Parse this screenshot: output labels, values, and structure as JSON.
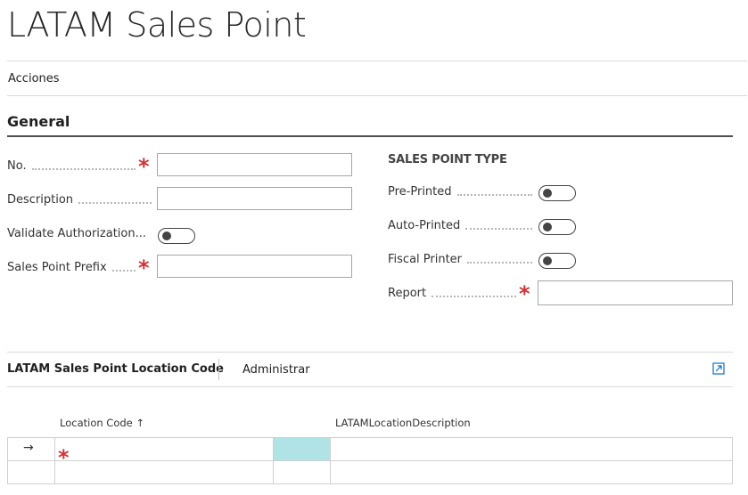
{
  "page": {
    "title": "LATAM Sales Point"
  },
  "actions": {
    "label": "Acciones"
  },
  "general": {
    "title": "General",
    "fields": {
      "no": {
        "label": "No.",
        "value": ""
      },
      "description": {
        "label": "Description",
        "value": ""
      },
      "validate_authorization": {
        "label": "Validate Authorization...",
        "value": false
      },
      "sales_point_prefix": {
        "label": "Sales Point Prefix",
        "value": ""
      }
    },
    "sales_point_type": {
      "title": "SALES POINT TYPE",
      "pre_printed": {
        "label": "Pre-Printed",
        "value": false
      },
      "auto_printed": {
        "label": "Auto-Printed",
        "value": false
      },
      "fiscal_printer": {
        "label": "Fiscal Printer",
        "value": false
      },
      "report": {
        "label": "Report",
        "value": ""
      }
    }
  },
  "location_part": {
    "title": "LATAM Sales Point Location Code",
    "manage_label": "Administrar",
    "columns": {
      "location_code": "Location Code ↑",
      "description": "LATAMLocationDescription"
    },
    "rows": [
      {
        "indicator": "→",
        "location_code": "",
        "description": ""
      },
      {
        "indicator": "",
        "location_code": "",
        "description": ""
      }
    ]
  },
  "colors": {
    "required": "#d13438",
    "selected_cell": "#b0e3e6",
    "section_rule": "#505050"
  }
}
